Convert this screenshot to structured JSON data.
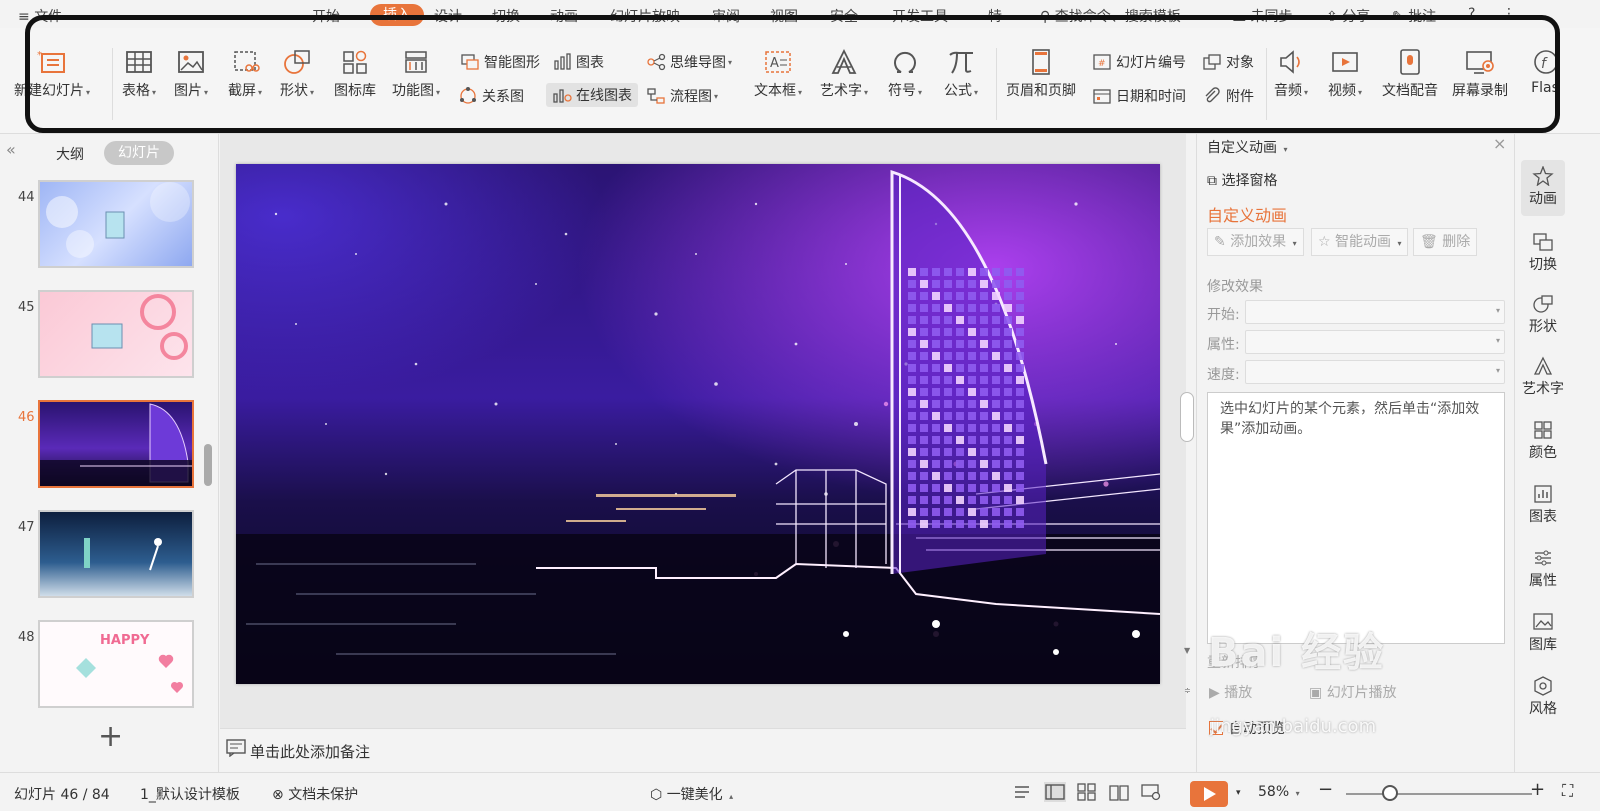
{
  "menubar": {
    "file": "文件",
    "tabs": [
      "开始",
      "插入",
      "设计",
      "切换",
      "动画",
      "幻灯片放映",
      "审阅",
      "视图",
      "安全",
      "开发工具",
      "特"
    ],
    "active_tab": "插入",
    "search": "查找命令、搜索模板",
    "sync": "未同步",
    "share": "分享",
    "comment": "批注"
  },
  "ribbon": {
    "new_slide": "新建幻灯片",
    "table": "表格",
    "picture": "图片",
    "screenshot": "截屏",
    "shape": "形状",
    "icon_lib": "图标库",
    "func_chart": "功能图",
    "smart_graphic": "智能图形",
    "chart": "图表",
    "relation": "关系图",
    "online_chart": "在线图表",
    "mindmap": "思维导图",
    "flowchart": "流程图",
    "textbox": "文本框",
    "wordart": "艺术字",
    "symbol": "符号",
    "formula": "公式",
    "header_footer": "页眉和页脚",
    "slide_number": "幻灯片编号",
    "object": "对象",
    "datetime": "日期和时间",
    "attachment": "附件",
    "audio": "音频",
    "video": "视频",
    "doc_voice": "文档配音",
    "screen_rec": "屏幕录制",
    "flash": "Flas",
    "highlight_color": "#111111"
  },
  "leftpanel": {
    "tab_outline": "大纲",
    "tab_slides": "幻灯片",
    "slides": [
      {
        "num": "44"
      },
      {
        "num": "45"
      },
      {
        "num": "46"
      },
      {
        "num": "47"
      },
      {
        "num": "48"
      }
    ],
    "active_slide": "46",
    "thumb_text_48": "HAPPY",
    "add": "+"
  },
  "notes": {
    "placeholder": "单击此处添加备注"
  },
  "animpane": {
    "title": "自定义动画",
    "select_pane": "选择窗格",
    "heading": "自定义动画",
    "add_effect": "添加效果",
    "smart_anim": "智能动画",
    "delete": "删除",
    "modify": "修改效果",
    "start": "开始:",
    "property": "属性:",
    "speed": "速度:",
    "hint": "选中幻灯片的某个元素，然后单击“添加效果”添加动画。",
    "reorder": "重新排序",
    "play": "播放",
    "slideshow": "幻灯片播放",
    "autopreview": "自动预览"
  },
  "rightbar": [
    "动画",
    "切换",
    "形状",
    "艺术字",
    "颜色",
    "图表",
    "属性",
    "图库",
    "风格"
  ],
  "status": {
    "slide_count": "幻灯片 46 / 84",
    "template": "1_默认设计模板",
    "protect": "文档未保护",
    "beautify": "一键美化",
    "zoom": "58%",
    "accent": "#e8743b"
  },
  "watermark": {
    "brand": "Bai  经验",
    "url": "jingyan.baidu.com"
  }
}
